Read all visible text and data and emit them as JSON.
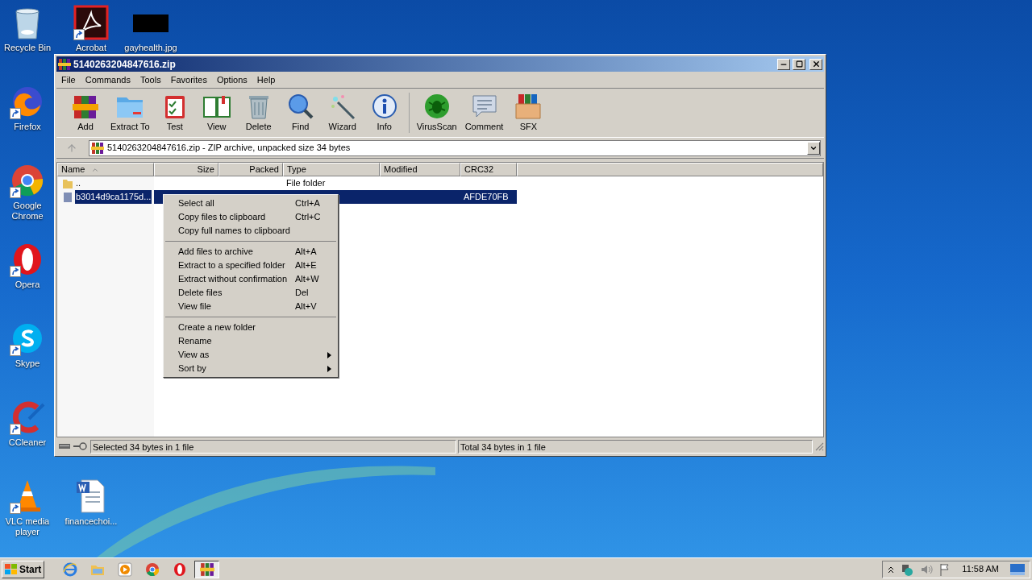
{
  "desktop_icons": [
    {
      "label": "Recycle Bin",
      "kind": "recycle",
      "shortcut": false
    },
    {
      "label": "Acrobat",
      "kind": "acrobat",
      "shortcut": true
    },
    {
      "label": "gayhealth.jpg",
      "kind": "thumbnail",
      "shortcut": false
    },
    {
      "label": "Firefox",
      "kind": "firefox",
      "shortcut": true
    },
    {
      "label": "Google Chrome",
      "kind": "chrome",
      "shortcut": true
    },
    {
      "label": "Opera",
      "kind": "opera",
      "shortcut": true
    },
    {
      "label": "Skype",
      "kind": "skype",
      "shortcut": true
    },
    {
      "label": "CCleaner",
      "kind": "ccleaner",
      "shortcut": true
    },
    {
      "label": "VLC media player",
      "kind": "vlc",
      "shortcut": true
    },
    {
      "label": "financechoi...",
      "kind": "word",
      "shortcut": false
    }
  ],
  "window": {
    "title": "5140263204847616.zip",
    "menu": [
      "File",
      "Commands",
      "Tools",
      "Favorites",
      "Options",
      "Help"
    ],
    "toolbar": [
      [
        {
          "label": "Add",
          "kind": "add"
        },
        {
          "label": "Extract To",
          "kind": "extract"
        },
        {
          "label": "Test",
          "kind": "test"
        },
        {
          "label": "View",
          "kind": "view"
        },
        {
          "label": "Delete",
          "kind": "delete"
        },
        {
          "label": "Find",
          "kind": "find"
        },
        {
          "label": "Wizard",
          "kind": "wizard"
        },
        {
          "label": "Info",
          "kind": "info"
        }
      ],
      [
        {
          "label": "VirusScan",
          "kind": "virusscan"
        },
        {
          "label": "Comment",
          "kind": "comment"
        },
        {
          "label": "SFX",
          "kind": "sfx"
        }
      ]
    ],
    "address": "5140263204847616.zip - ZIP archive, unpacked size 34 bytes",
    "columns": [
      {
        "label": "Name",
        "sorted": true
      },
      {
        "label": "Size",
        "sorted": false
      },
      {
        "label": "Packed",
        "sorted": false
      },
      {
        "label": "Type",
        "sorted": false
      },
      {
        "label": "Modified",
        "sorted": false
      },
      {
        "label": "CRC32",
        "sorted": false
      }
    ],
    "rows": [
      {
        "kind": "folder",
        "selected": false,
        "name": "..",
        "type": "File folder"
      },
      {
        "kind": "file",
        "selected": true,
        "name": "b3014d9ca1175d...",
        "crc32": "AFDE70FB"
      }
    ],
    "status_bar": {
      "left": "Selected 34 bytes in 1 file",
      "right": "Total 34 bytes in 1 file"
    }
  },
  "context_menu": [
    [
      {
        "label": "Select all",
        "shortcut": "Ctrl+A",
        "submenu": false
      },
      {
        "label": "Copy files to clipboard",
        "shortcut": "Ctrl+C",
        "submenu": false
      },
      {
        "label": "Copy full names to clipboard",
        "submenu": false
      }
    ],
    [
      {
        "label": "Add files to archive",
        "shortcut": "Alt+A",
        "submenu": false
      },
      {
        "label": "Extract to a specified folder",
        "shortcut": "Alt+E",
        "submenu": false
      },
      {
        "label": "Extract without confirmation",
        "shortcut": "Alt+W",
        "submenu": false
      },
      {
        "label": "Delete files",
        "shortcut": "Del",
        "submenu": false
      },
      {
        "label": "View file",
        "shortcut": "Alt+V",
        "submenu": false
      }
    ],
    [
      {
        "label": "Create a new folder",
        "submenu": false
      },
      {
        "label": "Rename",
        "submenu": false
      },
      {
        "label": "View as",
        "submenu": true
      },
      {
        "label": "Sort by",
        "submenu": true
      }
    ]
  ],
  "taskbar": {
    "start": "Start",
    "apps": [
      {
        "kind": "ie",
        "active": false
      },
      {
        "kind": "explorer",
        "active": false
      },
      {
        "kind": "media",
        "active": false
      },
      {
        "kind": "chrome",
        "active": false
      },
      {
        "kind": "opera",
        "active": false
      },
      {
        "kind": "winrar",
        "active": true
      }
    ],
    "clock": "11:58 AM"
  }
}
